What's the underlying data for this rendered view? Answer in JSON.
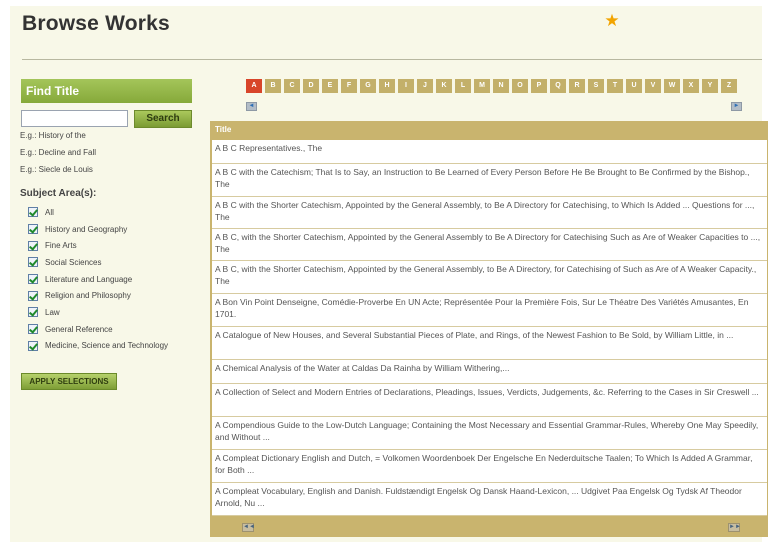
{
  "page_title": "Browse Works",
  "find": {
    "title": "Find Title",
    "search_value": "",
    "search_button": "Search",
    "examples": [
      "E.g.: History of the",
      "E.g.: Decline and Fall",
      "E.g.: Siecle de Louis"
    ]
  },
  "subjects": {
    "label": "Subject Area(s):",
    "items": [
      {
        "label": "All",
        "checked": true
      },
      {
        "label": "History and Geography",
        "checked": true
      },
      {
        "label": "Fine Arts",
        "checked": true
      },
      {
        "label": "Social Sciences",
        "checked": true
      },
      {
        "label": "Literature and Language",
        "checked": true
      },
      {
        "label": "Religion and Philosophy",
        "checked": true
      },
      {
        "label": "Law",
        "checked": true
      },
      {
        "label": "General Reference",
        "checked": true
      },
      {
        "label": "Medicine, Science and Technology",
        "checked": true
      }
    ],
    "apply_button": "APPLY SELECTIONS"
  },
  "alphabet": {
    "letters": [
      "A",
      "B",
      "C",
      "D",
      "E",
      "F",
      "G",
      "H",
      "I",
      "J",
      "K",
      "L",
      "M",
      "N",
      "O",
      "P",
      "Q",
      "R",
      "S",
      "T",
      "U",
      "V",
      "W",
      "X",
      "Y",
      "Z"
    ],
    "active": "A",
    "prev_arrow": "◄",
    "next_arrow": "►"
  },
  "table": {
    "header": "Title",
    "rows": [
      "A B C Representatives., The",
      "A B C with the Catechism; That Is to Say, an Instruction to Be Learned of Every Person Before He Be Brought to Be Confirmed by the Bishop., The",
      "A B C with the Shorter Catechism, Appointed by the General Assembly, to Be A Directory for Catechising, to Which Is Added ... Questions for ..., The",
      "A B C, with the Shorter Catechism, Appointed by the General Assembly to Be A Directory for Catechising Such as Are of Weaker Capacities to ..., The",
      "A B C, with the Shorter Catechism, Appointed by the General Assembly, to Be A Directory, for Catechising of Such as Are of A Weaker Capacity., The",
      "A Bon Vin Point Denseigne, Comédie-Proverbe En UN Acte; Représentée Pour la Première Fois, Sur Le Théatre Des Variétés Amusantes, En 1701.",
      "A Catalogue of New Houses, and Several Substantial Pieces of Plate, and Rings, of the Newest Fashion to Be Sold, by William Little, in ...",
      "A Chemical Analysis of the Water at Caldas Da Rainha by William Withering,...",
      "A Collection of Select and Modern Entries of Declarations, Pleadings, Issues, Verdicts, Judgements, &c. Referring to the Cases in Sir Creswell ...",
      "A Compendious Guide to the Low-Dutch Language; Containing the Most Necessary and Essential Grammar-Rules, Whereby One May Speedily, and Without ...",
      "A Compleat Dictionary English and Dutch, = Volkomen Woordenboek Der Engelsche En Nederduitsche Taalen; To Which Is Added A Grammar, for Both ...",
      "A Compleat Vocabulary, English and Danish. Fuldstændigt Engelsk Og Dansk Haand-Lexicon, ... Udgivet Paa Engelsk Og Tydsk Af Theodor Arnold, Nu ..."
    ],
    "footer_prev": "◄◄",
    "footer_next": "►►"
  },
  "colors": {
    "accent_green": "#8fb043",
    "table_tan": "#c9b46e",
    "active_letter": "#d8452a",
    "star": "#f2a400"
  }
}
